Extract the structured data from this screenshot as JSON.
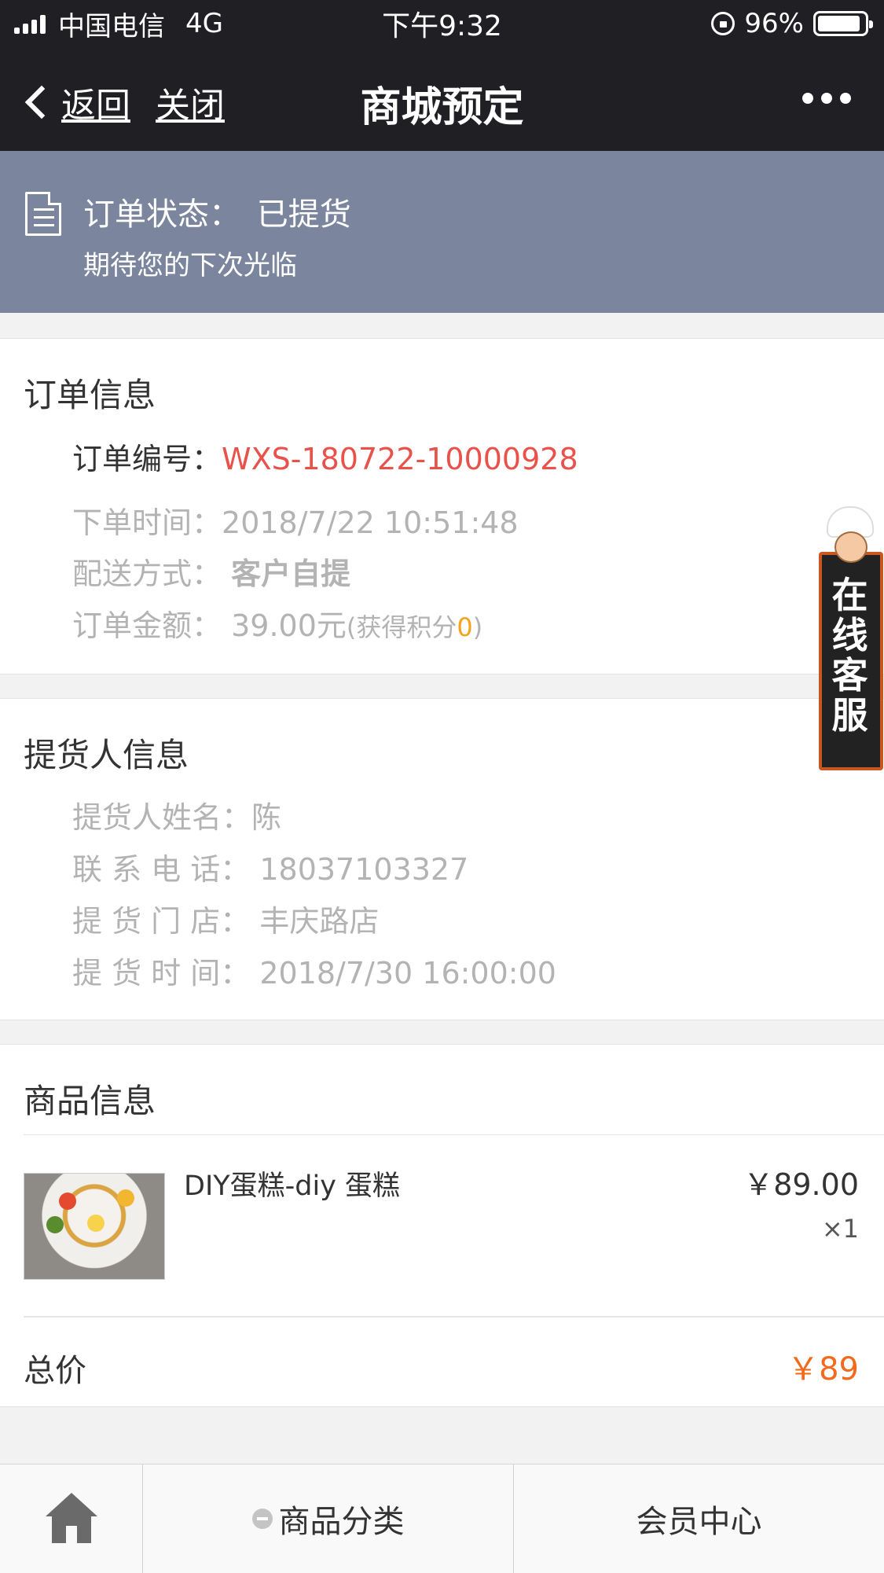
{
  "status_bar": {
    "carrier": "中国电信",
    "network": "4G",
    "time": "下午9:32",
    "battery": "96%"
  },
  "nav": {
    "back": "返回",
    "close": "关闭",
    "title": "商城预定",
    "more_icon": "more-dots-icon"
  },
  "order_status": {
    "label": "订单状态：",
    "value": "已提货",
    "subtitle": "期待您的下次光临"
  },
  "order_info": {
    "title": "订单信息",
    "number_label": "订单编号：",
    "number_value": "WXS-180722-10000928",
    "time_label": "下单时间：",
    "time_value": "2018/7/22 10:51:48",
    "delivery_label": "配送方式：",
    "delivery_value": "客户自提",
    "amount_label": "订单金额：",
    "amount_value": "39.00元",
    "points_prefix": "(获得积分",
    "points_value": "0",
    "points_suffix": ")"
  },
  "pickup_info": {
    "title": "提货人信息",
    "name_label": "提货人姓名：",
    "name_value": "陈",
    "phone_label": "联 系 电 话：",
    "phone_value": "18037103327",
    "store_label": "提 货 门 店：",
    "store_value": "丰庆路店",
    "time_label": "提 货 时 间：",
    "time_value": "2018/7/30 16:00:00"
  },
  "product_info": {
    "title": "商品信息",
    "items": [
      {
        "name": "DIY蛋糕-diy 蛋糕",
        "price": "￥89.00",
        "qty": "×1"
      }
    ],
    "total_label": "总价",
    "total_value": "￥89"
  },
  "customer_service": {
    "label": "在线客服"
  },
  "tab_bar": {
    "home_icon": "home-icon",
    "category": "商品分类",
    "member": "会员中心"
  },
  "colors": {
    "nav_bg": "#1f1f24",
    "status_banner": "#7b869e",
    "order_number": "#e9524a",
    "total_price": "#f26b1d",
    "points": "#f6a21a"
  }
}
